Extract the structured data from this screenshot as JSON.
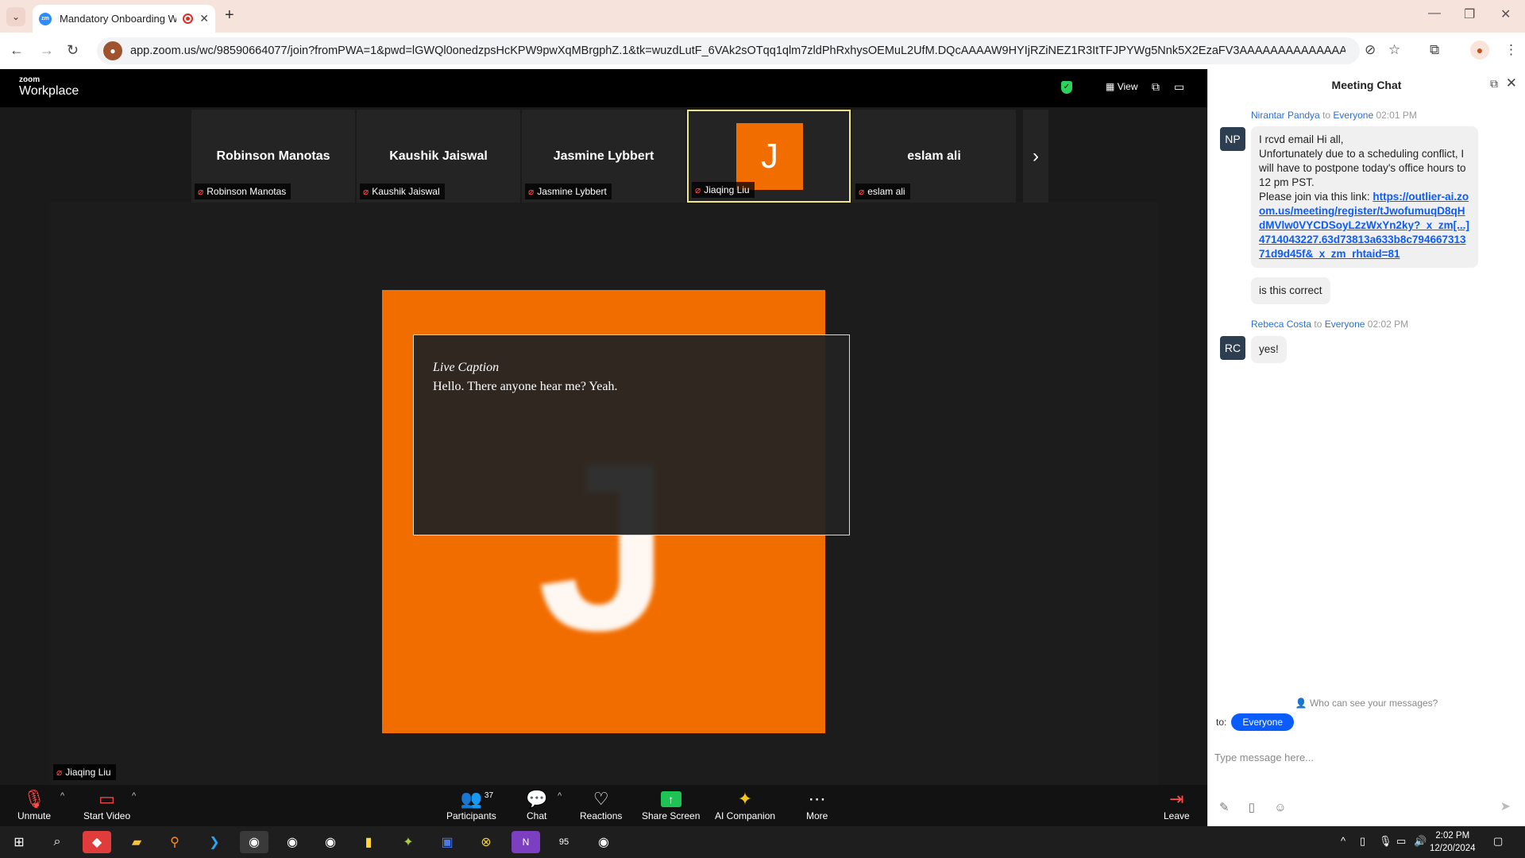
{
  "browser": {
    "tab_title": "Mandatory Onboarding We",
    "tab_favicon": "zm",
    "url": "app.zoom.us/wc/98590664077/join?fromPWA=1&pwd=lGWQl0onedzpsHcKPW9pwXqMBrgphZ.1&tk=wuzdLutF_6VAk2sOTqq1qlm7zldPhRxhysOEMuL2UfM.DQcAAAAW9HYIjRZiNEZ1R3ItTFJPYWg5Nnk5X2EzaFV3AAAAAAAAAAAAAAAAAAAAAAAAAAA..."
  },
  "zoom": {
    "logo_line1": "zoom",
    "logo_line2": "Workplace",
    "view_label": "View",
    "strip": [
      {
        "name": "Robinson Manotas",
        "tag": "Robinson Manotas"
      },
      {
        "name": "Kaushik Jaiswal",
        "tag": "Kaushik Jaiswal"
      },
      {
        "name": "Jasmine Lybbert",
        "tag": "Jasmine Lybbert"
      },
      {
        "initial": "J",
        "tag": "Jiaqing Liu"
      },
      {
        "name": "eslam ali",
        "tag": "eslam ali"
      }
    ],
    "main_speaker": {
      "initial": "J",
      "tag": "Jiaqing Liu"
    },
    "caption": {
      "title": "Live Caption",
      "text": "Hello. There anyone hear me? Yeah."
    },
    "controls": {
      "unmute": "Unmute",
      "start_video": "Start Video",
      "participants": "Participants",
      "participants_count": "37",
      "chat": "Chat",
      "reactions": "Reactions",
      "share_screen": "Share Screen",
      "ai_companion": "AI Companion",
      "more": "More",
      "leave": "Leave"
    }
  },
  "chat": {
    "title": "Meeting Chat",
    "messages": [
      {
        "sender": "Nirantar Pandya",
        "to_word": "to",
        "recipient": "Everyone",
        "time": "02:01 PM",
        "initials": "NP",
        "lines": [
          "I rcvd email Hi all,",
          "Unfortunately due to a scheduling conflict, I will have to postpone today's office hours to 12 pm PST.",
          "Please join via this link: "
        ],
        "link": "https://outlier-ai.zoom.us/meeting/register/tJwofumuqD8qHdMVlw0VYCDSoyL2zWxYn2ky?_x_zm[...]4714043227.63d73813a633b8c79466731371d9d45f&_x_zm_rhtaid=81",
        "followup": "is this correct"
      },
      {
        "sender": "Rebeca Costa",
        "to_word": "to",
        "recipient": "Everyone",
        "time": "02:02 PM",
        "initials": "RC",
        "text": "yes!"
      }
    ],
    "who_can_see": "Who can see your messages?",
    "to_label": "to:",
    "to_value": "Everyone",
    "input_placeholder": "Type message here..."
  },
  "taskbar": {
    "time": "2:02 PM",
    "date": "12/20/2024",
    "badge_95": "95"
  }
}
